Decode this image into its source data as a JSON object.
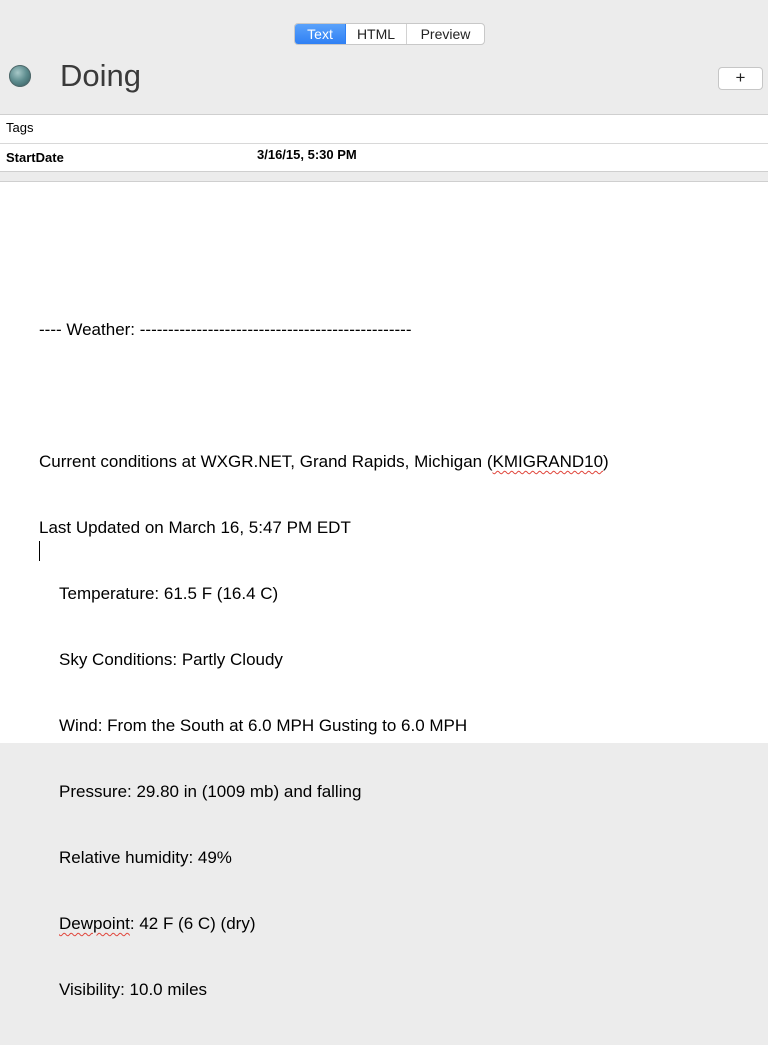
{
  "toolbar": {
    "tabs": [
      {
        "label": "Text",
        "active": true
      },
      {
        "label": "HTML",
        "active": false
      },
      {
        "label": "Preview",
        "active": false
      }
    ]
  },
  "header": {
    "title": "Doing",
    "add_label": "+",
    "status_icon": "status-dot-icon"
  },
  "fields": {
    "tags_label": "Tags",
    "tags_value": "",
    "startdate_label": "StartDate",
    "startdate_value": "3/16/15, 5:30 PM"
  },
  "note": {
    "heading": "---- Weather: ------------------------------------------------",
    "intro_prefix": "Current conditions at WXGR.NET, Grand Rapids, Michigan (",
    "station": "KMIGRAND10",
    "intro_suffix": ")",
    "updated": "Last Updated on March 16, 5:47 PM EDT",
    "temperature": "Temperature: 61.5 F (16.4 C)",
    "sky": "Sky Conditions: Partly Cloudy",
    "wind": "Wind: From the South at 6.0 MPH Gusting to 6.0 MPH",
    "pressure": "Pressure: 29.80 in (1009 mb) and falling",
    "humidity": "Relative humidity: 49%",
    "dewpoint_word": "Dewpoint",
    "dewpoint_rest": ": 42 F (6 C) (dry)",
    "visibility": "Visibility: 10.0 miles"
  },
  "colors": {
    "accent": "#2f80f4",
    "spellcheck": "#e0443a"
  }
}
